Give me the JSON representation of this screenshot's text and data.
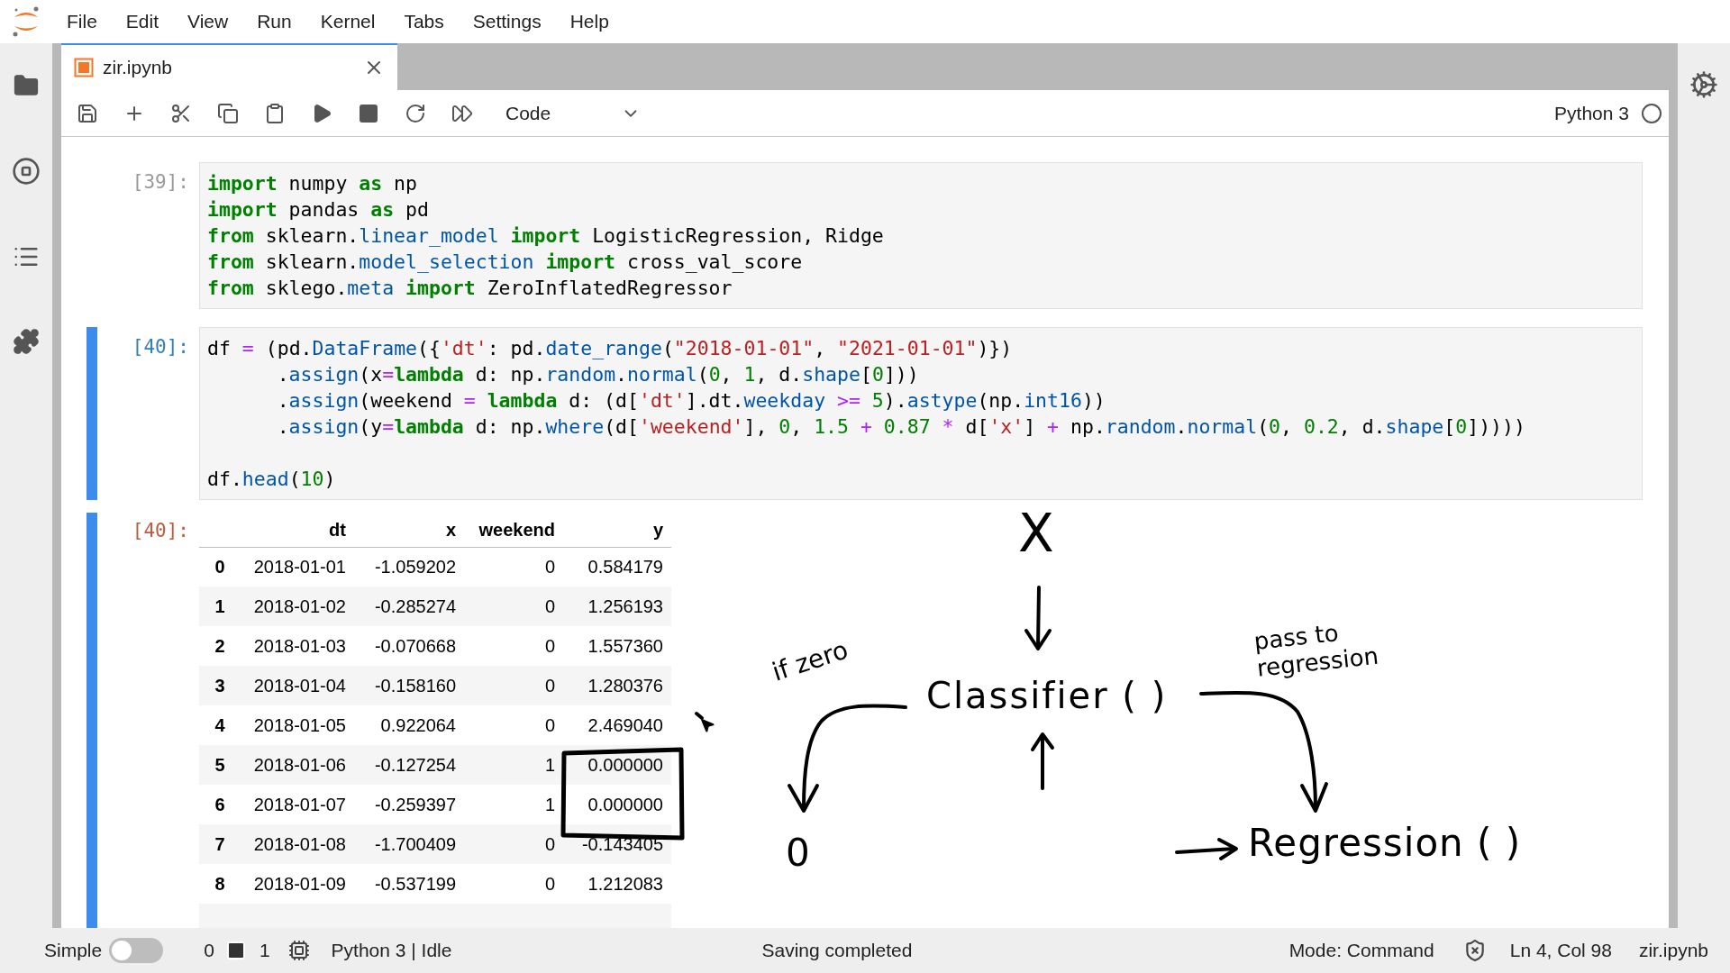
{
  "menu": [
    "File",
    "Edit",
    "View",
    "Run",
    "Kernel",
    "Tabs",
    "Settings",
    "Help"
  ],
  "tabs": [
    {
      "label": "zir.ipynb",
      "selected": true
    }
  ],
  "toolbar": {
    "cell_type": "Code",
    "kernel": "Python 3",
    "kernel_busy": false
  },
  "cells": [
    {
      "prompt": "[39]:",
      "active": false,
      "lines": [
        {
          "tokens": [
            {
              "kind": "kw",
              "text": "import"
            },
            {
              "kind": "text",
              "text": " numpy "
            },
            {
              "kind": "kw",
              "text": "as"
            },
            {
              "kind": "text",
              "text": " np"
            }
          ]
        },
        {
          "tokens": [
            {
              "kind": "kw",
              "text": "import"
            },
            {
              "kind": "text",
              "text": " pandas "
            },
            {
              "kind": "kw",
              "text": "as"
            },
            {
              "kind": "text",
              "text": " pd"
            }
          ]
        },
        {
          "tokens": [
            {
              "kind": "kw",
              "text": "from"
            },
            {
              "kind": "text",
              "text": " sklearn."
            },
            {
              "kind": "attr",
              "text": "linear_model"
            },
            {
              "kind": "kw",
              "text": " import"
            },
            {
              "kind": "text",
              "text": " LogisticRegression, Ridge"
            }
          ]
        },
        {
          "tokens": [
            {
              "kind": "kw",
              "text": "from"
            },
            {
              "kind": "text",
              "text": " sklearn."
            },
            {
              "kind": "attr",
              "text": "model_selection"
            },
            {
              "kind": "kw",
              "text": " import"
            },
            {
              "kind": "text",
              "text": " cross_val_score"
            }
          ]
        },
        {
          "tokens": [
            {
              "kind": "kw",
              "text": "from"
            },
            {
              "kind": "text",
              "text": " sklego."
            },
            {
              "kind": "attr",
              "text": "meta"
            },
            {
              "kind": "kw",
              "text": " import"
            },
            {
              "kind": "text",
              "text": " ZeroInflatedRegressor"
            }
          ]
        }
      ]
    },
    {
      "prompt": "[40]:",
      "active": true,
      "lines": [
        {
          "tokens": [
            {
              "kind": "text",
              "text": "df "
            },
            {
              "kind": "op",
              "text": "="
            },
            {
              "kind": "text",
              "text": " (pd."
            },
            {
              "kind": "attr",
              "text": "DataFrame"
            },
            {
              "kind": "text",
              "text": "({"
            },
            {
              "kind": "str",
              "text": "'dt'"
            },
            {
              "kind": "text",
              "text": ": pd."
            },
            {
              "kind": "attr",
              "text": "date_range"
            },
            {
              "kind": "text",
              "text": "("
            },
            {
              "kind": "str",
              "text": "\"2018-01-01\""
            },
            {
              "kind": "text",
              "text": ", "
            },
            {
              "kind": "str",
              "text": "\"2021-01-01\""
            },
            {
              "kind": "text",
              "text": ")})"
            }
          ]
        },
        {
          "tokens": [
            {
              "kind": "text",
              "text": "      ."
            },
            {
              "kind": "attr",
              "text": "assign"
            },
            {
              "kind": "text",
              "text": "(x"
            },
            {
              "kind": "op",
              "text": "="
            },
            {
              "kind": "kw",
              "text": "lambda"
            },
            {
              "kind": "text",
              "text": " d: np."
            },
            {
              "kind": "attr",
              "text": "random"
            },
            {
              "kind": "text",
              "text": "."
            },
            {
              "kind": "attr",
              "text": "normal"
            },
            {
              "kind": "text",
              "text": "("
            },
            {
              "kind": "num",
              "text": "0"
            },
            {
              "kind": "text",
              "text": ", "
            },
            {
              "kind": "num",
              "text": "1"
            },
            {
              "kind": "text",
              "text": ", d."
            },
            {
              "kind": "attr",
              "text": "shape"
            },
            {
              "kind": "text",
              "text": "["
            },
            {
              "kind": "num",
              "text": "0"
            },
            {
              "kind": "text",
              "text": "]))"
            }
          ]
        },
        {
          "tokens": [
            {
              "kind": "text",
              "text": "      ."
            },
            {
              "kind": "attr",
              "text": "assign"
            },
            {
              "kind": "text",
              "text": "(weekend "
            },
            {
              "kind": "op",
              "text": "="
            },
            {
              "kind": "kw",
              "text": " lambda"
            },
            {
              "kind": "text",
              "text": " d: (d["
            },
            {
              "kind": "str",
              "text": "'dt'"
            },
            {
              "kind": "text",
              "text": "].dt."
            },
            {
              "kind": "attr",
              "text": "weekday"
            },
            {
              "kind": "op",
              "text": " >= "
            },
            {
              "kind": "num",
              "text": "5"
            },
            {
              "kind": "text",
              "text": ")."
            },
            {
              "kind": "attr",
              "text": "astype"
            },
            {
              "kind": "text",
              "text": "(np."
            },
            {
              "kind": "attr",
              "text": "int16"
            },
            {
              "kind": "text",
              "text": "))"
            }
          ]
        },
        {
          "tokens": [
            {
              "kind": "text",
              "text": "      ."
            },
            {
              "kind": "attr",
              "text": "assign"
            },
            {
              "kind": "text",
              "text": "(y"
            },
            {
              "kind": "op",
              "text": "="
            },
            {
              "kind": "kw",
              "text": "lambda"
            },
            {
              "kind": "text",
              "text": " d: np."
            },
            {
              "kind": "attr",
              "text": "where"
            },
            {
              "kind": "text",
              "text": "(d["
            },
            {
              "kind": "str",
              "text": "'weekend'"
            },
            {
              "kind": "text",
              "text": "], "
            },
            {
              "kind": "num",
              "text": "0"
            },
            {
              "kind": "text",
              "text": ", "
            },
            {
              "kind": "num",
              "text": "1.5"
            },
            {
              "kind": "op",
              "text": " + "
            },
            {
              "kind": "num",
              "text": "0.87"
            },
            {
              "kind": "op",
              "text": " *"
            },
            {
              "kind": "text",
              "text": " d["
            },
            {
              "kind": "str",
              "text": "'x'"
            },
            {
              "kind": "text",
              "text": "] "
            },
            {
              "kind": "op",
              "text": "+"
            },
            {
              "kind": "text",
              "text": " np."
            },
            {
              "kind": "attr",
              "text": "random"
            },
            {
              "kind": "text",
              "text": "."
            },
            {
              "kind": "attr",
              "text": "normal"
            },
            {
              "kind": "text",
              "text": "("
            },
            {
              "kind": "num",
              "text": "0"
            },
            {
              "kind": "text",
              "text": ", "
            },
            {
              "kind": "num",
              "text": "0.2"
            },
            {
              "kind": "text",
              "text": ", d."
            },
            {
              "kind": "attr",
              "text": "shape"
            },
            {
              "kind": "text",
              "text": "["
            },
            {
              "kind": "num",
              "text": "0"
            },
            {
              "kind": "text",
              "text": "]))))"
            }
          ]
        },
        {
          "blank_before": true,
          "tokens": [
            {
              "kind": "text",
              "text": "df."
            },
            {
              "kind": "attr",
              "text": "head"
            },
            {
              "kind": "text",
              "text": "("
            },
            {
              "kind": "num",
              "text": "10"
            },
            {
              "kind": "text",
              "text": ")"
            }
          ]
        }
      ],
      "output": {
        "prompt": "[40]:",
        "table": {
          "columns": [
            "dt",
            "x",
            "weekend",
            "y"
          ],
          "rows": [
            {
              "index": "0",
              "cells": [
                "2018-01-01",
                "-1.059202",
                "0",
                "0.584179"
              ]
            },
            {
              "index": "1",
              "cells": [
                "2018-01-02",
                "-0.285274",
                "0",
                "1.256193"
              ]
            },
            {
              "index": "2",
              "cells": [
                "2018-01-03",
                "-0.070668",
                "0",
                "1.557360"
              ]
            },
            {
              "index": "3",
              "cells": [
                "2018-01-04",
                "-0.158160",
                "0",
                "1.280376"
              ]
            },
            {
              "index": "4",
              "cells": [
                "2018-01-05",
                "0.922064",
                "0",
                "2.469040"
              ]
            },
            {
              "index": "5",
              "cells": [
                "2018-01-06",
                "-0.127254",
                "1",
                "0.000000"
              ]
            },
            {
              "index": "6",
              "cells": [
                "2018-01-07",
                "-0.259397",
                "1",
                "0.000000"
              ]
            },
            {
              "index": "7",
              "cells": [
                "2018-01-08",
                "-1.700409",
                "0",
                "-0.143405"
              ]
            },
            {
              "index": "8",
              "cells": [
                "2018-01-09",
                "-0.537199",
                "0",
                "1.212083"
              ]
            }
          ]
        }
      }
    }
  ],
  "annotations": [
    {
      "text": "X"
    },
    {
      "text": "if zero"
    },
    {
      "text": "Classifier ( )"
    },
    {
      "text": "pass to regression"
    },
    {
      "text": "0"
    },
    {
      "text": "Regression ( )"
    }
  ],
  "status_bar": {
    "simple_mode": {
      "label": "Simple",
      "on": false
    },
    "terminal_count": "0",
    "kernel_count": "1",
    "kernel_status": "Python 3 | Idle",
    "message": "Saving completed",
    "mode": "Mode: Command",
    "position": "Ln 4, Col 98",
    "file": "zir.ipynb"
  }
}
